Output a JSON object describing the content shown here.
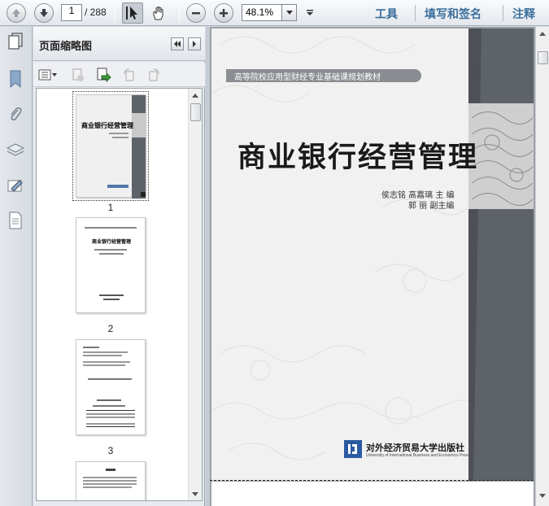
{
  "toolbar": {
    "current_page": "1",
    "total_pages": "/ 288",
    "zoom": "48.1%",
    "right_tabs": [
      "工具",
      "填写和签名",
      "注释"
    ]
  },
  "thumbnails_panel": {
    "title": "页面缩略图",
    "pages": [
      {
        "label": "1",
        "selected": true
      },
      {
        "label": "2",
        "selected": false
      },
      {
        "label": "3",
        "selected": false
      }
    ]
  },
  "document": {
    "series": "高等院校应用型财经专业基础课规划教材",
    "title": "商业银行经营管理",
    "authors_line1": "侯志铭  高嘉璃  主  编",
    "authors_line2": "郭    丽  副主编",
    "publisher": "对外经济贸易大学出版社",
    "publisher_en": "University of International Business and Economics Press",
    "publisher_logo_icon": "uibe-logo"
  },
  "thumb_page1": {
    "title": "商业银行经营管理"
  },
  "thumb_page2": {
    "title": "商业银行经营管理"
  },
  "colors": {
    "accent_tab": "#3a6e9c",
    "cover_band": "#5e636a",
    "publisher_blue": "#2c5aa0"
  }
}
